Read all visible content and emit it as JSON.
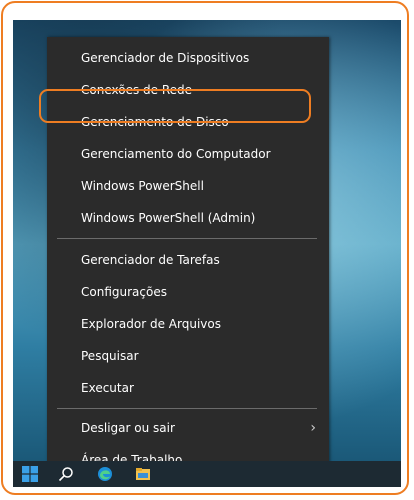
{
  "menu": {
    "items": [
      {
        "label": "Gerenciador de Dispositivos"
      },
      {
        "label": "Conexões de Rede"
      },
      {
        "label": "Gerenciamento de Disco"
      },
      {
        "label": "Gerenciamento do Computador"
      },
      {
        "label": "Windows PowerShell"
      },
      {
        "label": "Windows PowerShell (Admin)"
      },
      {
        "label": "Gerenciador de Tarefas"
      },
      {
        "label": "Configurações"
      },
      {
        "label": "Explorador de Arquivos"
      },
      {
        "label": "Pesquisar"
      },
      {
        "label": "Executar"
      },
      {
        "label": "Desligar ou sair"
      },
      {
        "label": "Área de Trabalho"
      }
    ],
    "submenu_indicator": "›"
  },
  "taskbar": {
    "icons": [
      "windows-start-icon",
      "search-icon",
      "edge-browser-icon",
      "file-explorer-icon"
    ]
  },
  "colors": {
    "highlight": "#ee7d22",
    "menu_background": "#2b2b2b",
    "taskbar_background": "#1d2a33"
  }
}
